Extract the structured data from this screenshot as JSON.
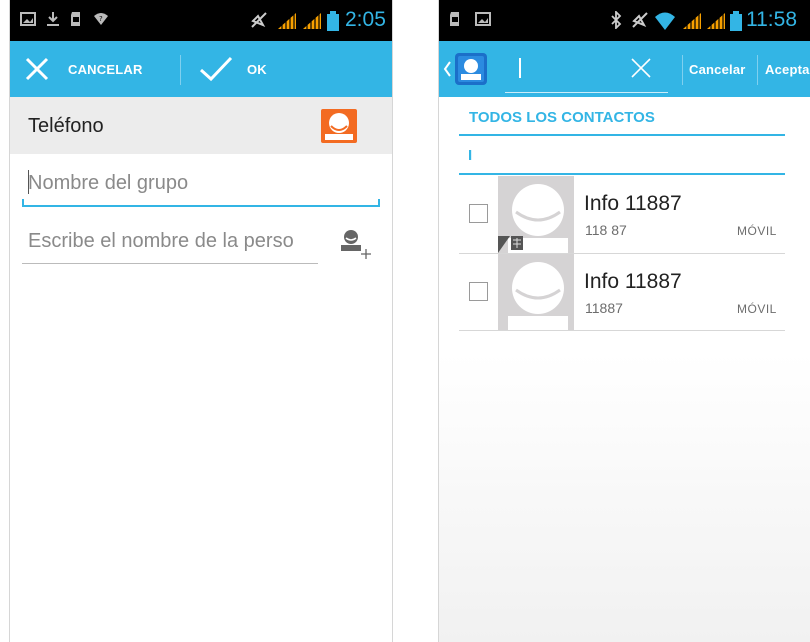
{
  "left": {
    "status": {
      "time": "2:05"
    },
    "actionbar": {
      "cancel_label": "CANCELAR",
      "ok_label": "OK"
    },
    "phone_label": "Teléfono",
    "group_name_placeholder": "Nombre del grupo",
    "person_name_placeholder": "Escribe el nombre de la perso"
  },
  "right": {
    "status": {
      "time": "11:58"
    },
    "search": {
      "value": "l"
    },
    "actionbar": {
      "cancel_label": "Cancelar",
      "accept_label": "Acepta"
    },
    "section_title": "TODOS LOS CONTACTOS",
    "filter_char": "I",
    "contacts": [
      {
        "name": "Info 11887",
        "number": "118 87",
        "type": "MÓVIL"
      },
      {
        "name": "Info 11887",
        "number": "11887",
        "type": "MÓVIL"
      }
    ]
  },
  "colors": {
    "accent": "#33b5e5",
    "contact_button": "#f36b22",
    "status_bar": "#000000"
  }
}
